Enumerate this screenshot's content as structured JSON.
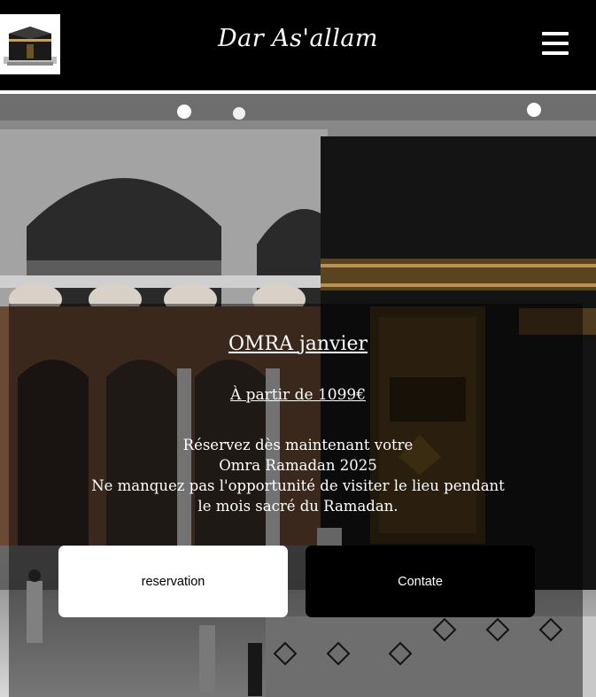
{
  "header": {
    "brand": "Dar As'allam",
    "logo_icon": "kaaba-logo-icon",
    "menu_icon": "hamburger-menu-icon"
  },
  "hero": {
    "title_part1": "OMRA",
    "title_part2": "janvier",
    "price": "À partir de 1099€",
    "description": [
      "Réservez dès maintenant votre",
      "Omra Ramadan 2025",
      "Ne manquez pas l'opportunité de visiter le lieu pendant",
      "le mois sacré du Ramadan."
    ],
    "reservation_label": "reservation",
    "contact_label": "Contate"
  },
  "colors": {
    "header_bg": "#000000",
    "button_light": "#ffffff",
    "button_dark": "#000000"
  }
}
